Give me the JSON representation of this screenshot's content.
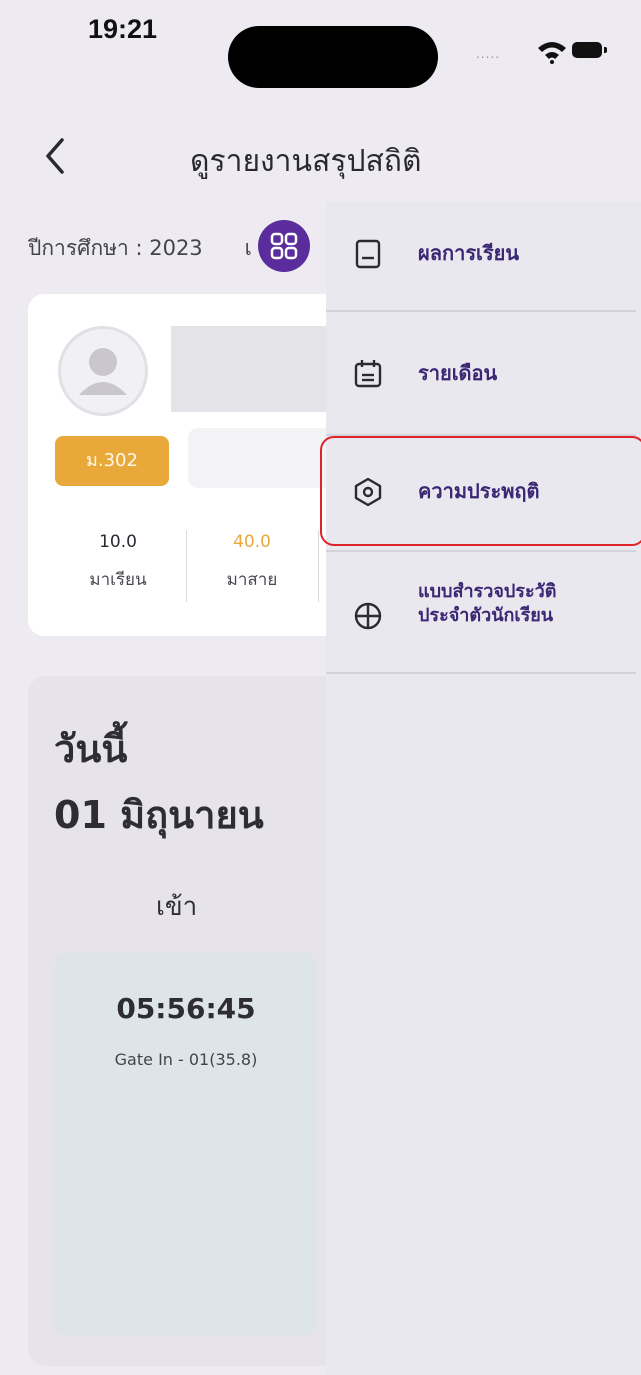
{
  "status_bar": {
    "time": "19:21",
    "signal": "....."
  },
  "header": {
    "title": "ดูรายงานสรุปสถิติ"
  },
  "academic_year": {
    "text": "ปีการศึกษา : 2023",
    "suffix": "เ"
  },
  "student_card": {
    "class_badge": "ม.302",
    "stats": [
      {
        "value": "10.0",
        "label": "มาเรียน",
        "color": "#2b2a33"
      },
      {
        "value": "40.0",
        "label": "มาสาย",
        "color": "#e8a93a"
      }
    ]
  },
  "today": {
    "title_line1": "วันนี้",
    "title_line2": "01 มิถุนายน",
    "check_in_label": "เข้า",
    "check_in_time": "05:56:45",
    "gate": "Gate In - 01(35.8)"
  },
  "side_menu": {
    "items": [
      {
        "label": "ผลการเรียน",
        "icon": "book-icon"
      },
      {
        "label": "รายเดือน",
        "icon": "calendar-icon"
      },
      {
        "label": "ความประพฤติ",
        "icon": "hexagon-icon",
        "highlighted": true
      },
      {
        "label_line1": "แบบสำรวจประวัติ",
        "label_line2": "ประจำตัวนักเรียน",
        "icon": "globe-icon"
      }
    ]
  },
  "colors": {
    "accent": "#5b2c9c",
    "badge": "#e8a93a",
    "menu_text": "#3b2774",
    "highlight": "#e0232a"
  }
}
